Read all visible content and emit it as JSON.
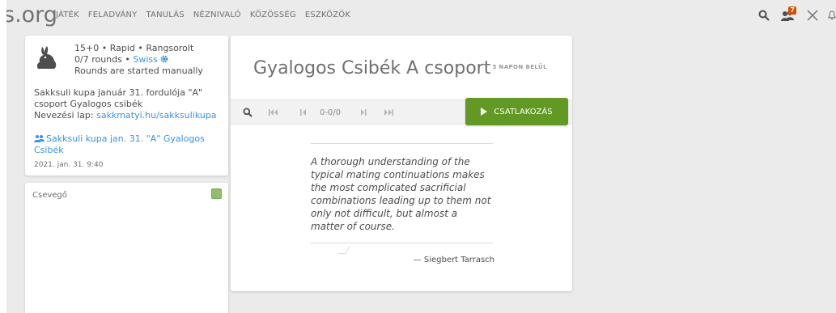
{
  "header": {
    "logo": "s.org",
    "nav": [
      "JÁTÉK",
      "FELADVÁNY",
      "TANULÁS",
      "NÉZNIVALÓ",
      "KÖZÖSSÉG",
      "ESZKÖZÖK"
    ],
    "icons": [
      "search-icon",
      "friends-icon",
      "challenge-icon",
      "bell-icon"
    ],
    "friends_badge": "7"
  },
  "side": {
    "icon": "rabbit-icon",
    "line1": "15+0 • Rapid • Rangsorolt",
    "rounds": "0/7 rounds • ",
    "swiss": "Swiss",
    "line3": "Rounds are started manually",
    "desc": "Sakksuli kupa január 31. fordulója \"A\" csoport Gyalogos csibék",
    "entry_prefix": "Nevezési lap: ",
    "entry_link": "sakkmatyi.hu/sakksulikupa",
    "team_link": "Sakksuli kupa jan. 31. \"A\" Gyalogos Csibék",
    "date": "2021. jan. 31. 9:40"
  },
  "chat": {
    "title": "Csevegő"
  },
  "main": {
    "title": "Gyalogos Csibék A csoport",
    "subtitle": "3 NAPON BELÜL",
    "score": "0-0/0",
    "join": "CSATLAKOZÁS",
    "quote": "A thorough understanding of the typical mating continuations makes the most complicated sacrificial combinations leading up to them not only not difficult, but almost a matter of course.",
    "author": "— Siegbert Tarrasch"
  },
  "colors": {
    "accent_green": "#629924",
    "link_blue": "#3893e8"
  }
}
